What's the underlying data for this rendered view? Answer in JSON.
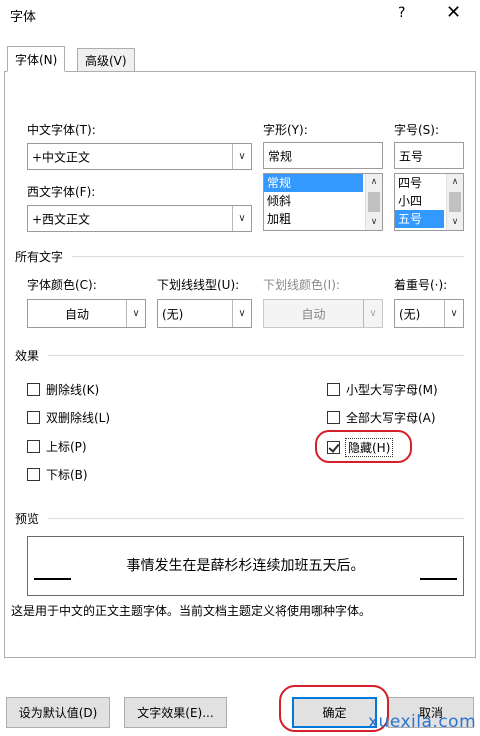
{
  "window": {
    "title": "字体",
    "help_label": "?",
    "close_label": "✕"
  },
  "tabs": [
    {
      "label": "字体(N)"
    },
    {
      "label": "高级(V)"
    }
  ],
  "font_section": {
    "chinese_font_label": "中文字体(T):",
    "chinese_font_value": "+中文正文",
    "western_font_label": "西文字体(F):",
    "western_font_value": "+西文正文",
    "style_label": "字形(Y):",
    "style_value": "常规",
    "style_options": [
      "常规",
      "倾斜",
      "加粗"
    ],
    "size_label": "字号(S):",
    "size_value": "五号",
    "size_options": [
      "四号",
      "小四",
      "五号"
    ]
  },
  "all_text": {
    "section_label": "所有文字",
    "font_color_label": "字体颜色(C):",
    "font_color_value": "自动",
    "underline_style_label": "下划线线型(U):",
    "underline_style_value": "(无)",
    "underline_color_label": "下划线颜色(I):",
    "underline_color_value": "自动",
    "emphasis_label": "着重号(·):",
    "emphasis_value": "(无)"
  },
  "effects": {
    "section_label": "效果",
    "strikethrough": {
      "label": "删除线(K)",
      "checked": false
    },
    "double_strikethrough": {
      "label": "双删除线(L)",
      "checked": false
    },
    "superscript": {
      "label": "上标(P)",
      "checked": false
    },
    "subscript": {
      "label": "下标(B)",
      "checked": false
    },
    "small_caps": {
      "label": "小型大写字母(M)",
      "checked": false
    },
    "all_caps": {
      "label": "全部大写字母(A)",
      "checked": false
    },
    "hidden": {
      "label": "隐藏(H)",
      "checked": true
    }
  },
  "preview": {
    "section_label": "预览",
    "sample_text": "事情发生在是薛杉杉连续加班五天后。",
    "note": "这是用于中文的正文主题字体。当前文档主题定义将使用哪种字体。"
  },
  "buttons": {
    "set_default": "设为默认值(D)",
    "text_effects": "文字效果(E)...",
    "ok": "确定",
    "cancel": "取消"
  },
  "watermark": "xuexila.com",
  "colors": {
    "accent": "#0078d7",
    "selection": "#3399ff",
    "annotation_red": "#d4202a",
    "watermark": "#2a74d0"
  }
}
